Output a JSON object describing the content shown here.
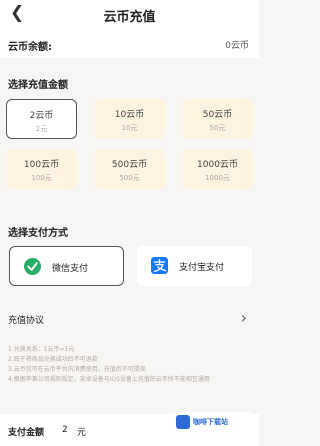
{
  "header": {
    "back_icon": "back-arrow-icon",
    "title": "云币充值"
  },
  "balance": {
    "label": "云币余额:",
    "value": "0云币"
  },
  "amount_section": {
    "title": "选择充值金额"
  },
  "amounts": [
    {
      "coins": "2云币",
      "price": "2元",
      "selected": true
    },
    {
      "coins": "10云币",
      "price": "10元",
      "selected": false
    },
    {
      "coins": "50云币",
      "price": "50元",
      "selected": false
    },
    {
      "coins": "100云币",
      "price": "100元",
      "selected": false
    },
    {
      "coins": "500云币",
      "price": "500元",
      "selected": false
    },
    {
      "coins": "1000云币",
      "price": "1000元",
      "selected": false
    }
  ],
  "payment_section": {
    "title": "选择支付方式"
  },
  "payment_methods": [
    {
      "label": "微信支付",
      "icon": "wechat-pay-icon",
      "color": "#2aae67",
      "selected": true
    },
    {
      "label": "支付宝支付",
      "icon": "alipay-icon",
      "color": "#1677ff",
      "selected": false
    }
  ],
  "agreement": {
    "label": "充值协议",
    "icon": "chevron-right-icon"
  },
  "rules": [
    "1.兑换关系：1云币=1元",
    "2.既于将商品兑换成功后不可退款",
    "3.云币仅可在云币平台内消费使用，充值后不可提现",
    "4.根据苹果公司规则规定，安卓设备与iOS设备上充值的云币所不能相互通用"
  ],
  "footer": {
    "label": "支付金额",
    "amount": "2",
    "unit": "元"
  },
  "watermark": {
    "text": "咖啡下载站"
  },
  "colors": {
    "accent_bg": "#fdf3df",
    "page_bg": "#f7f6f4"
  }
}
